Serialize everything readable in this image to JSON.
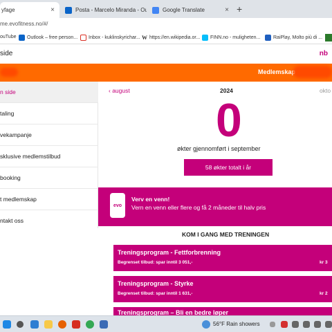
{
  "browser": {
    "tabs": [
      {
        "label": "yfage",
        "active": true
      },
      {
        "label": "Posta - Marcelo Miranda - Outl",
        "active": false
      },
      {
        "label": "Google Translate",
        "active": false
      }
    ],
    "new_tab": "+",
    "tab_close": "×",
    "url": "me.evofitness.no/#/",
    "bookmarks": [
      {
        "label": "ouTube",
        "icon": "youtube-icon"
      },
      {
        "label": "Outlook – free person...",
        "icon": "outlook-icon"
      },
      {
        "label": "Inbox - kuklinskyrichar...",
        "icon": "gmail-icon"
      },
      {
        "label": "https://en.wikipedia.or...",
        "icon": "wikipedia-icon"
      },
      {
        "label": "FINN.no - muligheten...",
        "icon": "finn-icon"
      },
      {
        "label": "RaiPlay, Molto più di ...",
        "icon": "raiplay-icon"
      }
    ]
  },
  "site": {
    "header_left": "side",
    "lang": "nb",
    "orange_title": "Medlemskap",
    "sidebar": [
      {
        "label": "n side",
        "active": true
      },
      {
        "label": "taling",
        "active": false
      },
      {
        "label": "vekampanje",
        "active": false
      },
      {
        "label": "sklusive medlemstilbud",
        "active": false
      },
      {
        "label": "booking",
        "active": false
      },
      {
        "label": "t medlemskap",
        "active": false
      },
      {
        "label": "ntakt oss",
        "active": false
      }
    ],
    "calendar": {
      "prev": "‹  august",
      "year": "2024",
      "next": "okto"
    },
    "sessions_count": "0",
    "sessions_caption": "økter gjennomført i september",
    "total_button": "58 økter totalt i år",
    "referral": {
      "logo": "evo",
      "title": "Verv en venn!",
      "text": "Vern en venn eller flere og få 2 måneder til halv pris"
    },
    "get_started": "KOM I GANG MED TRENINGEN",
    "programs": [
      {
        "title": "Treningsprogram - Fettforbrenning",
        "offer": "Begrenset tilbud: spar inntil 3 051,-",
        "price": "kr 3"
      },
      {
        "title": "Treningsprogram - Styrke",
        "offer": "Begrenset tilbud: spar inntil 1 631,-",
        "price": "kr 2"
      },
      {
        "title": "Treningsprogram – Bli en bedre løper",
        "offer": "",
        "price": ""
      }
    ]
  },
  "taskbar": {
    "weather": "56°F  Rain showers",
    "colors": {
      "accent": "#c4007a",
      "orange": "#ff6a00"
    }
  }
}
